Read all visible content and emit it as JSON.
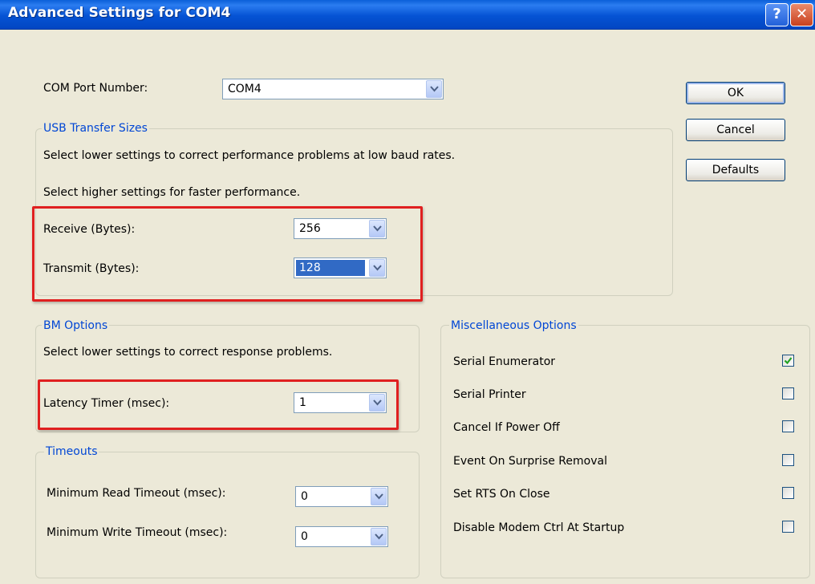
{
  "window": {
    "title": "Advanced Settings for COM4",
    "help_glyph": "?",
    "close_glyph": "✕"
  },
  "com_port": {
    "label": "COM Port Number:",
    "value": "COM4"
  },
  "buttons": {
    "ok": "OK",
    "cancel": "Cancel",
    "defaults": "Defaults"
  },
  "usb": {
    "legend": "USB Transfer Sizes",
    "hint_low": "Select lower settings to correct performance problems at low baud rates.",
    "hint_high": "Select higher settings for faster performance.",
    "receive_label": "Receive (Bytes):",
    "receive_value": "256",
    "transmit_label": "Transmit (Bytes):",
    "transmit_value": "128"
  },
  "bm": {
    "legend": "BM Options",
    "hint": "Select lower settings to correct response problems.",
    "latency_label": "Latency Timer (msec):",
    "latency_value": "1"
  },
  "timeouts": {
    "legend": "Timeouts",
    "read_label": "Minimum Read Timeout (msec):",
    "read_value": "0",
    "write_label": "Minimum Write Timeout (msec):",
    "write_value": "0"
  },
  "misc": {
    "legend": "Miscellaneous Options",
    "options": [
      {
        "label": "Serial Enumerator",
        "checked": true
      },
      {
        "label": "Serial Printer",
        "checked": false
      },
      {
        "label": "Cancel If Power Off",
        "checked": false
      },
      {
        "label": "Event On Surprise Removal",
        "checked": false
      },
      {
        "label": "Set RTS On Close",
        "checked": false
      },
      {
        "label": "Disable Modem Ctrl At Startup",
        "checked": false
      }
    ]
  },
  "colors": {
    "titlebar": "#0553d4",
    "legend": "#0046d5",
    "highlight": "#e02020",
    "selection": "#316ac5"
  }
}
